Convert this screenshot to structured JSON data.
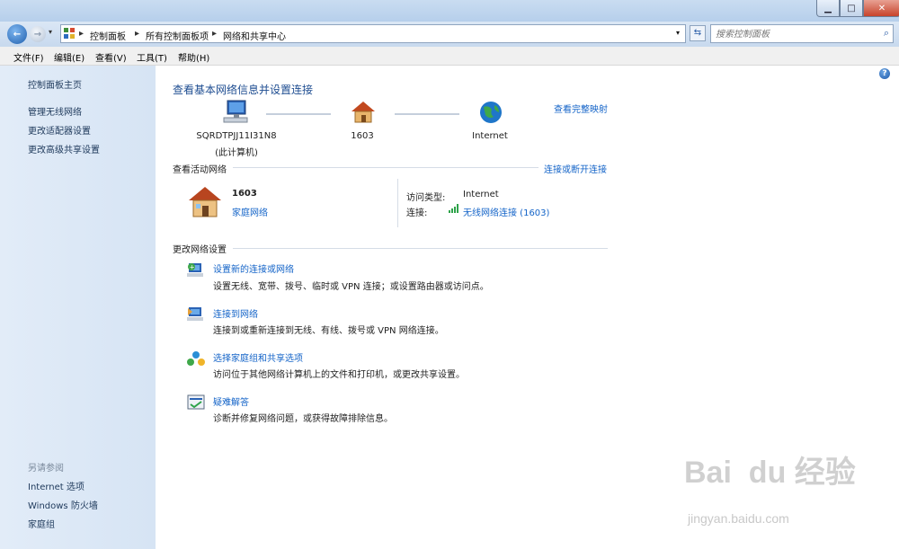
{
  "breadcrumb": [
    "控制面板",
    "所有控制面板项",
    "网络和共享中心"
  ],
  "search": {
    "placeholder": "搜索控制面板"
  },
  "menu": [
    "文件(F)",
    "编辑(E)",
    "查看(V)",
    "工具(T)",
    "帮助(H)"
  ],
  "sidebar": {
    "items": [
      "控制面板主页",
      "管理无线网络",
      "更改适配器设置",
      "更改高级共享设置"
    ],
    "see_also_title": "另请参阅",
    "see_also": [
      "Internet 选项",
      "Windows 防火墙",
      "家庭组"
    ]
  },
  "main": {
    "title": "查看基本网络信息并设置连接",
    "full_map": "查看完整映射",
    "map": {
      "computer_name": "SQRDTPJJ11I31N8",
      "computer_sub": "(此计算机)",
      "network_name": "1603",
      "internet": "Internet"
    },
    "active_title": "查看活动网络",
    "connect_disconnect": "连接或断开连接",
    "network": {
      "name": "1603",
      "type": "家庭网络",
      "access_label": "访问类型:",
      "access_value": "Internet",
      "conn_label": "连接:",
      "conn_value": "无线网络连接 (1603)"
    },
    "settings_title": "更改网络设置",
    "tasks": [
      {
        "title": "设置新的连接或网络",
        "desc": "设置无线、宽带、拨号、临时或 VPN 连接；或设置路由器或访问点。"
      },
      {
        "title": "连接到网络",
        "desc": "连接到或重新连接到无线、有线、拨号或 VPN 网络连接。"
      },
      {
        "title": "选择家庭组和共享选项",
        "desc": "访问位于其他网络计算机上的文件和打印机，或更改共享设置。"
      },
      {
        "title": "疑难解答",
        "desc": "诊断并修复网络问题，或获得故障排除信息。"
      }
    ]
  },
  "watermark": {
    "brand": "Bai  du 经验",
    "url": "jingyan.baidu.com"
  }
}
